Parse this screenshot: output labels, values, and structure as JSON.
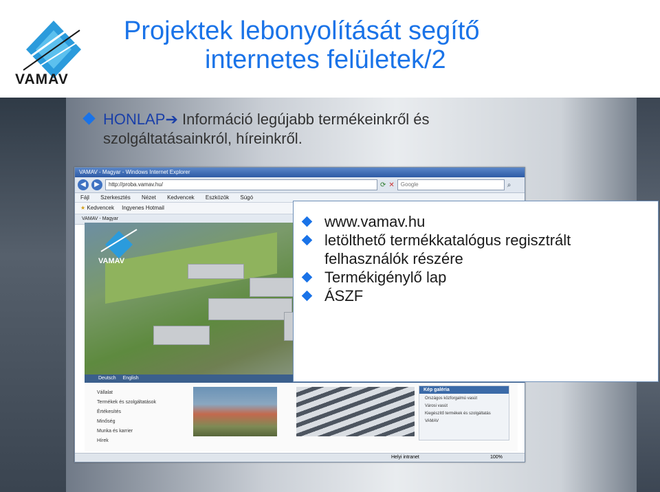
{
  "title": {
    "line1": "Projektek lebonyolítását segítő",
    "line2_main": "internetes felületek/",
    "line2_num": "2"
  },
  "logo": {
    "text": "VAMAV",
    "icon": "vamav-logo-icon"
  },
  "headline": {
    "label": "HONLAP",
    "arrow": "➔",
    "text_line1": " Információ legújabb termékeinkről és",
    "text_line2": "szolgáltatásainkról, híreinkről."
  },
  "browser": {
    "window_title": "VAMAV - Magyar - Windows Internet Explorer",
    "url": "http://proba.vamav.hu/",
    "search_placeholder": "Google",
    "menu": [
      "Fájl",
      "Szerkesztés",
      "Nézet",
      "Kedvencek",
      "Eszközök",
      "Súgó"
    ],
    "favorites": "Kedvencek",
    "fav_link": "Ingyenes Hotmail",
    "tab_title": "VAMAV - Magyar",
    "hero_logo": "VAMAV",
    "langs": [
      "Deutsch",
      "English"
    ],
    "sidenav": [
      "Vállalat",
      "Termékek és szolgáltatások",
      "Értékesítés",
      "Minőség",
      "Munka és karrier",
      "Hírek"
    ],
    "gallery_header": "Kép galéria",
    "gallery_links": [
      "Országos közforgalmú vasút",
      "Városi vasút",
      "Kiegészítő termékek és szolgáltatás",
      "VAMAV"
    ],
    "status_zone": "Helyi intranet",
    "status_zoom": "100%"
  },
  "overlay_items": [
    "www.vamav.hu",
    "letölthető termékkatalógus regisztrált felhasználók részére",
    "Termékigénylő lap",
    "ÁSZF"
  ],
  "colors": {
    "accent": "#1a73e8",
    "dark_blue": "#1a3fa8"
  }
}
